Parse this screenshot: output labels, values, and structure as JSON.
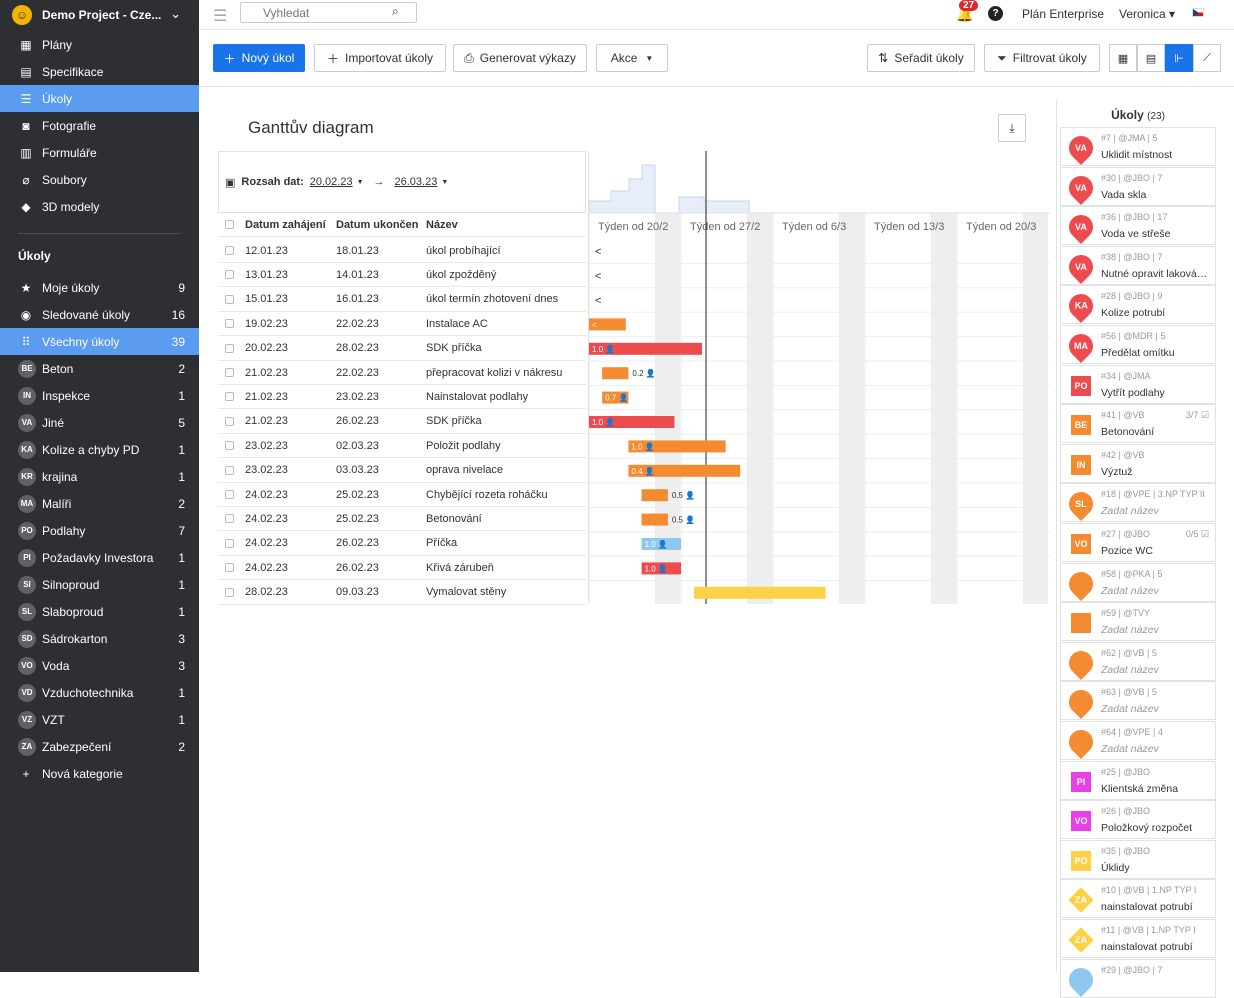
{
  "sidebar": {
    "project": "Demo Project - Cze...",
    "nav": [
      {
        "label": "Plány",
        "icon": "plans-icon",
        "glyph": "▦"
      },
      {
        "label": "Specifikace",
        "icon": "specification-icon",
        "glyph": "▤"
      },
      {
        "label": "Úkoly",
        "icon": "tasks-icon",
        "glyph": "☰",
        "active": true
      },
      {
        "label": "Fotografie",
        "icon": "camera-icon",
        "glyph": "◙"
      },
      {
        "label": "Formuláře",
        "icon": "clipboard-icon",
        "glyph": "▥"
      },
      {
        "label": "Soubory",
        "icon": "paperclip-icon",
        "glyph": "⌀"
      },
      {
        "label": "3D modely",
        "icon": "cube-icon",
        "glyph": "◆"
      }
    ],
    "tasks_heading": "Úkoly",
    "task_filters": [
      {
        "label": "Moje úkoly",
        "count": "9",
        "glyph": "★",
        "icon": "star-icon"
      },
      {
        "label": "Sledované úkoly",
        "count": "16",
        "glyph": "◉",
        "icon": "eye-icon"
      },
      {
        "label": "Všechny úkoly",
        "count": "39",
        "glyph": "⠿",
        "icon": "grid-icon",
        "active": true
      }
    ],
    "categories": [
      {
        "badge": "BE",
        "label": "Beton",
        "count": "2"
      },
      {
        "badge": "IN",
        "label": "Inspekce",
        "count": "1"
      },
      {
        "badge": "VA",
        "label": "Jiné",
        "count": "5"
      },
      {
        "badge": "KA",
        "label": "Kolize a chyby PD",
        "count": "1"
      },
      {
        "badge": "KR",
        "label": "krajina",
        "count": "1"
      },
      {
        "badge": "MA",
        "label": "Malíři",
        "count": "2"
      },
      {
        "badge": "PO",
        "label": "Podlahy",
        "count": "7"
      },
      {
        "badge": "PI",
        "label": "Požadavky Investora",
        "count": "1"
      },
      {
        "badge": "SI",
        "label": "Silnoproud",
        "count": "1"
      },
      {
        "badge": "SL",
        "label": "Slaboproud",
        "count": "1"
      },
      {
        "badge": "SD",
        "label": "Sádrokarton",
        "count": "3"
      },
      {
        "badge": "VO",
        "label": "Voda",
        "count": "3"
      },
      {
        "badge": "VD",
        "label": "Vzduchotechnika",
        "count": "1"
      },
      {
        "badge": "VZ",
        "label": "VZT",
        "count": "1"
      },
      {
        "badge": "ZA",
        "label": "Zabezpečení",
        "count": "2"
      }
    ],
    "new_category": "Nová kategorie"
  },
  "topbar": {
    "search_placeholder": "Vyhledat",
    "notifications": "27",
    "help": "?",
    "plan": "Plán Enterprise",
    "user": "Veronica ▾"
  },
  "toolbar": {
    "new_task": "Nový úkol",
    "import_tasks": "Importovat úkoly",
    "generate_reports": "Generovat výkazy",
    "actions": "Akce",
    "sort_tasks": "Seřadit úkoly",
    "filter_tasks": "Filtrovat úkoly"
  },
  "gantt": {
    "title": "Ganttův diagram",
    "range_label": "Rozsah dat:",
    "range_from": "20.02.23",
    "range_to": "26.03.23",
    "columns": [
      "Datum zahájení",
      "Datum ukončení",
      "Název"
    ],
    "weeks": [
      "Týden od 20/2",
      "Týden od 27/2",
      "Týden od 6/3",
      "Týden od 13/3",
      "Týden od 20/3"
    ],
    "rows": [
      {
        "start": "12.01.23",
        "end": "18.01.23",
        "name": "úkol probíhající",
        "bar": {
          "type": "arrow"
        }
      },
      {
        "start": "13.01.23",
        "end": "14.01.23",
        "name": "úkol zpožděný",
        "bar": {
          "type": "arrow"
        }
      },
      {
        "start": "15.01.23",
        "end": "16.01.23",
        "name": "úkol termín zhotovení dnes",
        "bar": {
          "type": "arrow"
        }
      },
      {
        "start": "19.02.23",
        "end": "22.02.23",
        "name": "Instalace AC",
        "bar": {
          "type": "bar",
          "from": -0.1,
          "days": 2.8,
          "color": "#f48b30",
          "label": "<"
        }
      },
      {
        "start": "20.02.23",
        "end": "28.02.23",
        "name": "SDK příčka",
        "bar": {
          "type": "bar",
          "from": 0,
          "days": 8.6,
          "color": "#ee4b4f",
          "label": "1.0"
        }
      },
      {
        "start": "21.02.23",
        "end": "22.02.23",
        "name": "přepracovat kolizi v nákresu",
        "bar": {
          "type": "bar",
          "from": 1,
          "days": 2,
          "color": "#f48b30",
          "label": "0.2",
          "outside": true
        }
      },
      {
        "start": "21.02.23",
        "end": "23.02.23",
        "name": "Nainstalovat podlahy",
        "bar": {
          "type": "bar",
          "from": 1,
          "days": 2,
          "color": "#f48b30",
          "label": "0.7"
        }
      },
      {
        "start": "21.02.23",
        "end": "26.02.23",
        "name": "SDK příčka",
        "bar": {
          "type": "bar",
          "from": 0,
          "days": 6.5,
          "color": "#ee4b4f",
          "label": "1.0"
        }
      },
      {
        "start": "23.02.23",
        "end": "02.03.23",
        "name": "Položit podlahy",
        "bar": {
          "type": "bar",
          "from": 3,
          "days": 7.4,
          "color": "#f48b30",
          "label": "1.0"
        }
      },
      {
        "start": "23.02.23",
        "end": "03.03.23",
        "name": "oprava nivelace",
        "bar": {
          "type": "bar",
          "from": 3,
          "days": 8.5,
          "color": "#f48b30",
          "label": "0.4"
        }
      },
      {
        "start": "24.02.23",
        "end": "25.02.23",
        "name": "Chybějící rozeta roháčku",
        "bar": {
          "type": "bar",
          "from": 4,
          "days": 2,
          "color": "#f48b30",
          "label": "0.5",
          "outside": true
        }
      },
      {
        "start": "24.02.23",
        "end": "25.02.23",
        "name": "Betonování",
        "bar": {
          "type": "bar",
          "from": 4,
          "days": 2,
          "color": "#f48b30",
          "label": "0.5",
          "outside": true
        }
      },
      {
        "start": "24.02.23",
        "end": "26.02.23",
        "name": "Příčka",
        "bar": {
          "type": "bar",
          "from": 4,
          "days": 3,
          "color": "#8ec8ef",
          "label": "1.0"
        }
      },
      {
        "start": "24.02.23",
        "end": "26.02.23",
        "name": "Křivá zárubeň",
        "bar": {
          "type": "bar",
          "from": 4,
          "days": 3,
          "color": "#ee4b4f",
          "label": "1.0"
        }
      },
      {
        "start": "28.02.23",
        "end": "09.03.23",
        "name": "Vymalovat stěny",
        "bar": {
          "type": "bar",
          "from": 8,
          "days": 10,
          "color": "#fdd046",
          "label": ""
        }
      }
    ]
  },
  "task_list": {
    "title": "Úkoly",
    "count": "(23)",
    "cards": [
      {
        "marker": "pin",
        "color": "#ee4b4f",
        "abbr": "VA",
        "meta": "#7 | @JMA | 5",
        "title": "Uklidit místnost"
      },
      {
        "marker": "pin",
        "color": "#ee4b4f",
        "abbr": "VA",
        "meta": "#30 | @JBO | 7",
        "title": "Vada skla"
      },
      {
        "marker": "pin",
        "color": "#ee4b4f",
        "abbr": "VA",
        "meta": "#36 | @JBO | 17",
        "title": "Voda ve střeše"
      },
      {
        "marker": "pin",
        "color": "#ee4b4f",
        "abbr": "VA",
        "meta": "#38 | @JBO | 7",
        "title": "Nutné opravit laková…"
      },
      {
        "marker": "pin",
        "color": "#ee4b4f",
        "abbr": "KA",
        "meta": "#28 | @JBO | 9",
        "title": "Kolize potrubí"
      },
      {
        "marker": "pin",
        "color": "#ee4b4f",
        "abbr": "MA",
        "meta": "#56 | @MDR | 5",
        "title": "Předělat omítku"
      },
      {
        "marker": "sq",
        "color": "#ee4b4f",
        "abbr": "PO",
        "meta": "#34 | @JMA",
        "title": "Vytřít podlahy"
      },
      {
        "marker": "sq",
        "color": "#f48b30",
        "abbr": "BE",
        "meta": "#41 | @VB",
        "title": "Betonování",
        "count": "3/7 ☑"
      },
      {
        "marker": "sq",
        "color": "#f48b30",
        "abbr": "IN",
        "meta": "#42 | @VB",
        "title": "Výztuž"
      },
      {
        "marker": "pin",
        "color": "#f48b30",
        "abbr": "SL",
        "meta": "#18 | @VPE | 3.NP TYP II",
        "title": "Zadat název",
        "placeholder": true
      },
      {
        "marker": "sq",
        "color": "#f48b30",
        "abbr": "VO",
        "meta": "#27 | @JBO",
        "title": "Pozice WC",
        "count": "0/5 ☑"
      },
      {
        "marker": "pin",
        "color": "#f48b30",
        "abbr": "",
        "meta": "#58 | @PKA | 5",
        "title": "Zadat název",
        "placeholder": true
      },
      {
        "marker": "sq",
        "color": "#f48b30",
        "abbr": "",
        "meta": "#59 | @TVY",
        "title": "Zadat název",
        "placeholder": true
      },
      {
        "marker": "pin",
        "color": "#f48b30",
        "abbr": "",
        "meta": "#62 | @VB | 5",
        "title": "Zadat název",
        "placeholder": true
      },
      {
        "marker": "pin",
        "color": "#f48b30",
        "abbr": "",
        "meta": "#63 | @VB | 5",
        "title": "Zadat název",
        "placeholder": true
      },
      {
        "marker": "pin",
        "color": "#f48b30",
        "abbr": "",
        "meta": "#64 | @VPE | 4",
        "title": "Zadat název",
        "placeholder": true
      },
      {
        "marker": "sq",
        "color": "#e83fe8",
        "abbr": "PI",
        "meta": "#25 | @JBO",
        "title": "Klientská změna"
      },
      {
        "marker": "sq",
        "color": "#e83fe8",
        "abbr": "VO",
        "meta": "#26 | @JBO",
        "title": "Položkový rozpočet"
      },
      {
        "marker": "sq",
        "color": "#fdd046",
        "abbr": "PO",
        "meta": "#35 | @JBO",
        "title": "Úklidy"
      },
      {
        "marker": "dia",
        "color": "#fdd046",
        "abbr": "ZA",
        "meta": "#10 | @VB | 1.NP TYP I",
        "title": "nainstalovat potrubí"
      },
      {
        "marker": "dia",
        "color": "#fdd046",
        "abbr": "ZA",
        "meta": "#11 | @VB | 1.NP TYP I",
        "title": "nainstalovat potrubí"
      },
      {
        "marker": "pin",
        "color": "#8ec8ef",
        "abbr": "",
        "meta": "#29 | @JBO | 7",
        "title": ""
      }
    ]
  }
}
